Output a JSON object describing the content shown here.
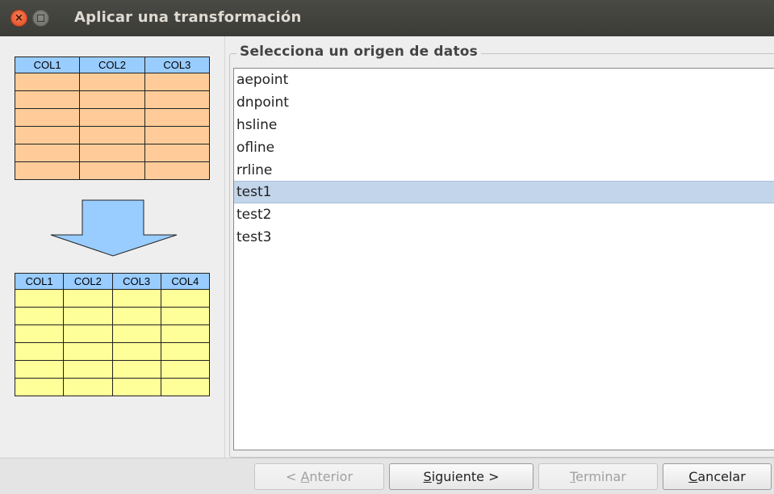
{
  "window": {
    "title": "Aplicar una transformación"
  },
  "illustration": {
    "source_columns": [
      "COL1",
      "COL2",
      "COL3"
    ],
    "target_columns": [
      "COL1",
      "COL2",
      "COL3",
      "COL4"
    ],
    "colors": {
      "header": "#99ccff",
      "source_rows": "#ffcc99",
      "target_rows": "#ffff99",
      "arrow": "#99ccff"
    }
  },
  "datasource": {
    "group_label": "Selecciona un origen de datos",
    "items": [
      "aepoint",
      "dnpoint",
      "hsline",
      "ofline",
      "rrline",
      "test1",
      "test2",
      "test3"
    ],
    "selected": "test1"
  },
  "buttons": {
    "previous": {
      "prefix": "< ",
      "mnemonic": "A",
      "rest": "nterior",
      "enabled": false
    },
    "next": {
      "mnemonic": "S",
      "rest": "iguiente >",
      "enabled": true
    },
    "finish": {
      "mnemonic": "T",
      "rest": "erminar",
      "enabled": false
    },
    "cancel": {
      "mnemonic": "C",
      "rest": "ancelar",
      "enabled": true
    }
  }
}
